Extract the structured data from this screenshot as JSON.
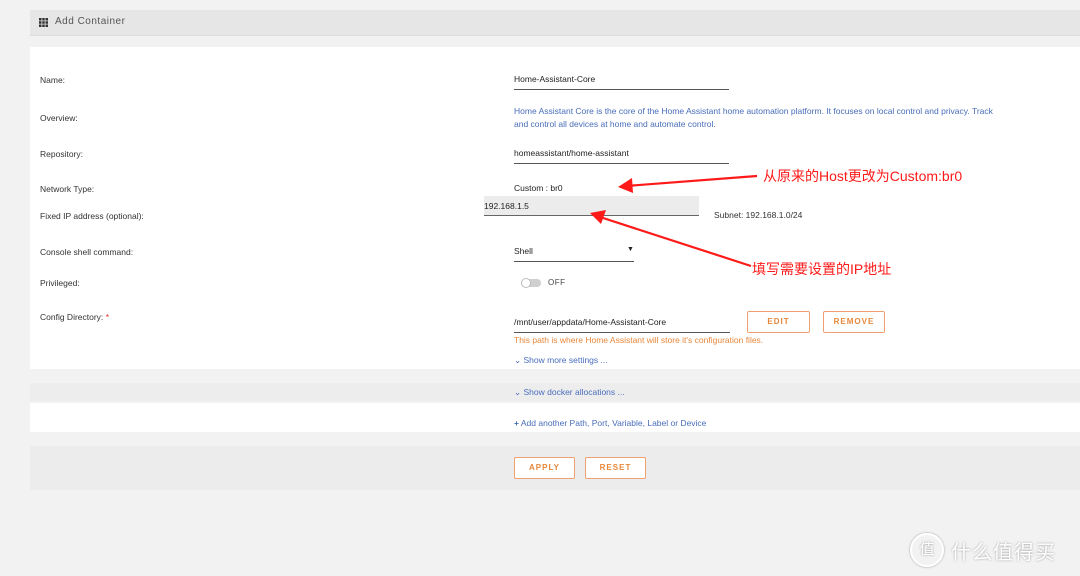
{
  "header": {
    "title": "Add Container"
  },
  "fields": {
    "name": {
      "label": "Name:",
      "value": "Home-Assistant-Core"
    },
    "overview": {
      "label": "Overview:",
      "line1": "Home Assistant Core is the core of the Home Assistant home automation platform. It focuses on local control and privacy. Track",
      "line2": "and control all devices at home and automate control."
    },
    "repository": {
      "label": "Repository:",
      "value": "homeassistant/home-assistant"
    },
    "network_type": {
      "label": "Network Type:",
      "value": "Custom : br0"
    },
    "fixed_ip": {
      "label": "Fixed IP address (optional):",
      "value": "192.168.1.5",
      "subnet": "Subnet: 192.168.1.0/24"
    },
    "console": {
      "label": "Console shell command:",
      "value": "Shell"
    },
    "privileged": {
      "label": "Privileged:",
      "state": "OFF"
    },
    "config_dir": {
      "label": "Config Directory:",
      "required_mark": "*",
      "value": "/mnt/user/appdata/Home-Assistant-Core",
      "hint": "This path is where Home Assistant will store it's configuration files.",
      "edit": "EDIT",
      "remove": "REMOVE"
    }
  },
  "links": {
    "more_settings": "Show more settings ...",
    "docker_allocations": "Show docker allocations ...",
    "add_another": "Add another Path, Port, Variable, Label or Device"
  },
  "actions": {
    "apply": "APPLY",
    "reset": "RESET"
  },
  "annotations": {
    "network_note": "从原来的Host更改为Custom:br0",
    "ip_note": "填写需要设置的IP地址"
  },
  "watermark": {
    "text": "什么值得买",
    "logo_char": "值"
  },
  "colors": {
    "accent": "#e8873a",
    "link": "#486dba",
    "annotation": "#ff1a1a"
  }
}
